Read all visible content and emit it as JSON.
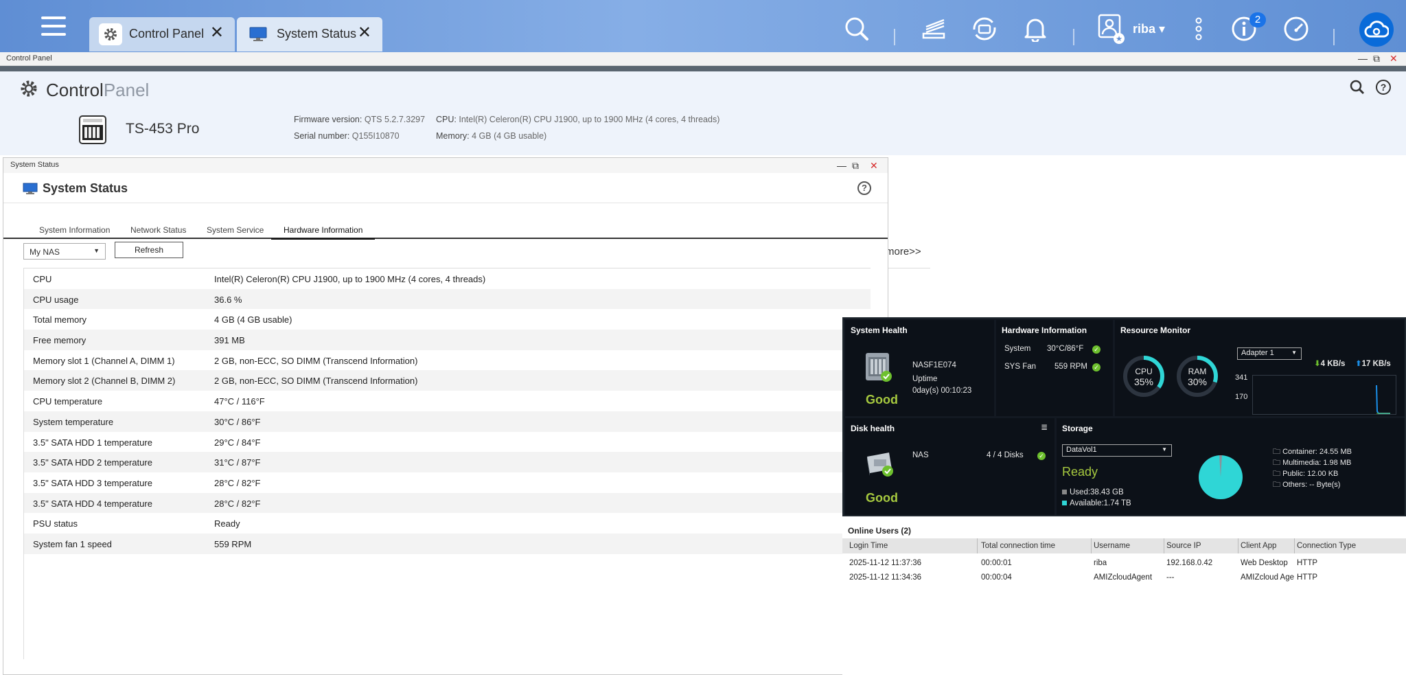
{
  "taskbar": {
    "tabs": [
      {
        "label": "Control Panel",
        "icon": "gear-icon"
      },
      {
        "label": "System Status",
        "icon": "monitor-icon"
      }
    ],
    "user": "riba",
    "notification_badge": "2"
  },
  "control_panel": {
    "window_title": "Control Panel",
    "title_main": "Control",
    "title_light": "Panel",
    "model": "TS-453 Pro",
    "firmware_label": "Firmware version:",
    "firmware_value": "QTS 5.2.7.3297",
    "serial_label": "Serial number:",
    "serial_value": "Q155I10870",
    "cpu_label": "CPU:",
    "cpu_value": "Intel(R) Celeron(R) CPU J1900, up to 1900 MHz (4 cores, 4 threads)",
    "memory_label": "Memory:",
    "memory_value": "4 GB (4 GB usable)",
    "more_link": "more>>"
  },
  "system_status": {
    "window_title": "System Status",
    "title": "System Status",
    "tabs": [
      "System Information",
      "Network Status",
      "System Service",
      "Hardware Information"
    ],
    "active_tab": "Hardware Information",
    "device_select": "My NAS",
    "refresh_label": "Refresh",
    "rows": [
      {
        "key": "CPU",
        "value": "Intel(R) Celeron(R) CPU J1900, up to 1900 MHz (4 cores, 4 threads)"
      },
      {
        "key": "CPU usage",
        "value": "36.6 %"
      },
      {
        "key": "Total memory",
        "value": "4 GB (4 GB usable)"
      },
      {
        "key": "Free memory",
        "value": "391 MB"
      },
      {
        "key": "Memory slot 1 (Channel A, DIMM 1)",
        "value": "2 GB, non-ECC, SO DIMM (Transcend Information)"
      },
      {
        "key": "Memory slot 2 (Channel B, DIMM 2)",
        "value": "2 GB, non-ECC, SO DIMM (Transcend Information)"
      },
      {
        "key": "CPU temperature",
        "value": "47°C / 116°F"
      },
      {
        "key": "System temperature",
        "value": "30°C / 86°F"
      },
      {
        "key": "3.5\" SATA HDD 1 temperature",
        "value": "29°C / 84°F"
      },
      {
        "key": "3.5\" SATA HDD 2 temperature",
        "value": "31°C / 87°F"
      },
      {
        "key": "3.5\" SATA HDD 3 temperature",
        "value": "28°C / 82°F"
      },
      {
        "key": "3.5\" SATA HDD 4 temperature",
        "value": "28°C / 82°F"
      },
      {
        "key": "PSU status",
        "value": "Ready"
      },
      {
        "key": "System fan 1 speed",
        "value": "559 RPM"
      }
    ]
  },
  "dashboard": {
    "system_health": {
      "title": "System Health",
      "name": "NASF1E074",
      "uptime_label": "Uptime",
      "uptime": "0day(s) 00:10:23",
      "status": "Good"
    },
    "hardware_info": {
      "title": "Hardware Information",
      "system_label": "System",
      "system_value": "30°C/86°F",
      "fan_label": "SYS Fan",
      "fan_value": "559 RPM"
    },
    "resource_monitor": {
      "title": "Resource Monitor",
      "adapter": "Adapter 1",
      "cpu_label": "CPU",
      "cpu_value": "35%",
      "cpu_percent": 35,
      "ram_label": "RAM",
      "ram_value": "30%",
      "ram_percent": 30,
      "download": "4 KB/s",
      "upload": "17 KB/s",
      "y_high": "341",
      "y_mid": "170"
    },
    "disk_health": {
      "title": "Disk health",
      "name": "NAS",
      "disks": "4 / 4 Disks",
      "status": "Good"
    },
    "storage": {
      "title": "Storage",
      "volume": "DataVol1",
      "status": "Ready",
      "used": "Used:38.43 GB",
      "available": "Available:1.74 TB",
      "container": "Container: 24.55 MB",
      "multimedia": "Multimedia: 1.98 MB",
      "public": "Public: 12.00 KB",
      "others": "Others: -- Byte(s)"
    }
  },
  "online_users": {
    "title": "Online Users (2)",
    "columns": [
      "Login Time",
      "Total connection time",
      "Username",
      "Source IP",
      "Client App",
      "Connection Type"
    ],
    "rows": [
      [
        "2025-11-12 11:37:36",
        "00:00:01",
        "riba",
        "192.168.0.42",
        "Web Desktop",
        "HTTP"
      ],
      [
        "2025-11-12 11:34:36",
        "00:00:04",
        "AMIZcloudAgent",
        "---",
        "AMIZcloud Agent",
        "HTTP"
      ]
    ]
  }
}
